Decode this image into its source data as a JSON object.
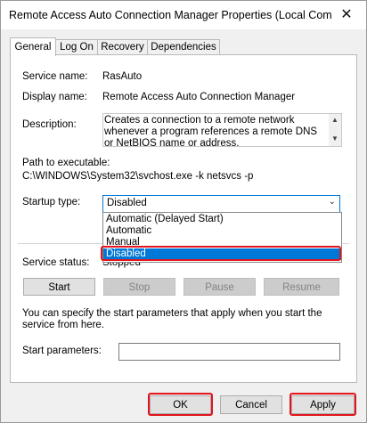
{
  "window": {
    "title": "Remote Access Auto Connection Manager Properties (Local Comp...",
    "close_glyph": "✕"
  },
  "tabs": [
    {
      "label": "General",
      "active": true
    },
    {
      "label": "Log On",
      "active": false
    },
    {
      "label": "Recovery",
      "active": false
    },
    {
      "label": "Dependencies",
      "active": false
    }
  ],
  "general": {
    "service_name_label": "Service name:",
    "service_name_value": "RasAuto",
    "display_name_label": "Display name:",
    "display_name_value": "Remote Access Auto Connection Manager",
    "description_label": "Description:",
    "description_value": "Creates a connection to a remote network whenever a program references a remote DNS or NetBIOS name or address.",
    "path_label": "Path to executable:",
    "path_value": "C:\\WINDOWS\\System32\\svchost.exe -k netsvcs -p",
    "startup_type_label": "Startup type:",
    "startup_type_value": "Disabled",
    "startup_options": [
      {
        "label": "Automatic (Delayed Start)",
        "selected": false
      },
      {
        "label": "Automatic",
        "selected": false
      },
      {
        "label": "Manual",
        "selected": false
      },
      {
        "label": "Disabled",
        "selected": true
      }
    ],
    "service_status_label": "Service status:",
    "service_status_value": "Stopped",
    "buttons": {
      "start": "Start",
      "stop": "Stop",
      "pause": "Pause",
      "resume": "Resume"
    },
    "params_note": "You can specify the start parameters that apply when you start the service from here.",
    "start_params_label": "Start parameters:",
    "start_params_value": ""
  },
  "footer": {
    "ok": "OK",
    "cancel": "Cancel",
    "apply": "Apply"
  },
  "colors": {
    "highlight": "#e3141b",
    "selection": "#0078d7"
  }
}
